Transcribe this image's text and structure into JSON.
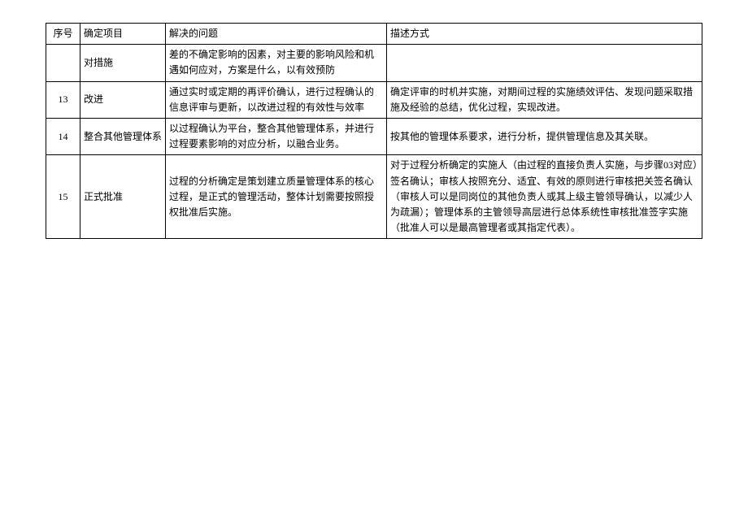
{
  "headers": {
    "num": "序号",
    "item": "确定项目",
    "problem": "解决的问题",
    "desc": "描述方式"
  },
  "rows": [
    {
      "num": "",
      "item": "对措施",
      "problem": "差的不确定影响的因素，对主要的影响风险和机遇如何应对，方案是什么，以有效预防",
      "desc": ""
    },
    {
      "num": "13",
      "item": "改进",
      "problem": "通过实时或定期的再评价确认，进行过程确认的信息评审与更新，以改进过程的有效性与效率",
      "desc": "确定评审的时机并实施，对期间过程的实施绩效评估、发现问题采取措施及经验的总结，优化过程，实现改进。"
    },
    {
      "num": "14",
      "item": "整合其他管理体系",
      "problem": "以过程确认为平台，整合其他管理体系，并进行过程要素影响的对应分析，以融合业务。",
      "desc": "按其他的管理体系要求，进行分析，提供管理信息及其关联。"
    },
    {
      "num": "15",
      "item": "正式批准",
      "problem": "过程的分析确定是策划建立质量管理体系的核心过程，是正式的管理活动，整体计划需要按照授权批准后实施。",
      "desc": "对于过程分析确定的实施人（由过程的直接负责人实施，与步骤03对应）签名确认；审核人按照充分、适宜、有效的原则进行审核把关签名确认（审核人可以是同岗位的其他负责人或其上级主管领导确认，以减少人为疏漏）；管理体系的主管领导高层进行总体系统性审核批准签字实施（批准人可以是最高管理者或其指定代表）。"
    }
  ]
}
